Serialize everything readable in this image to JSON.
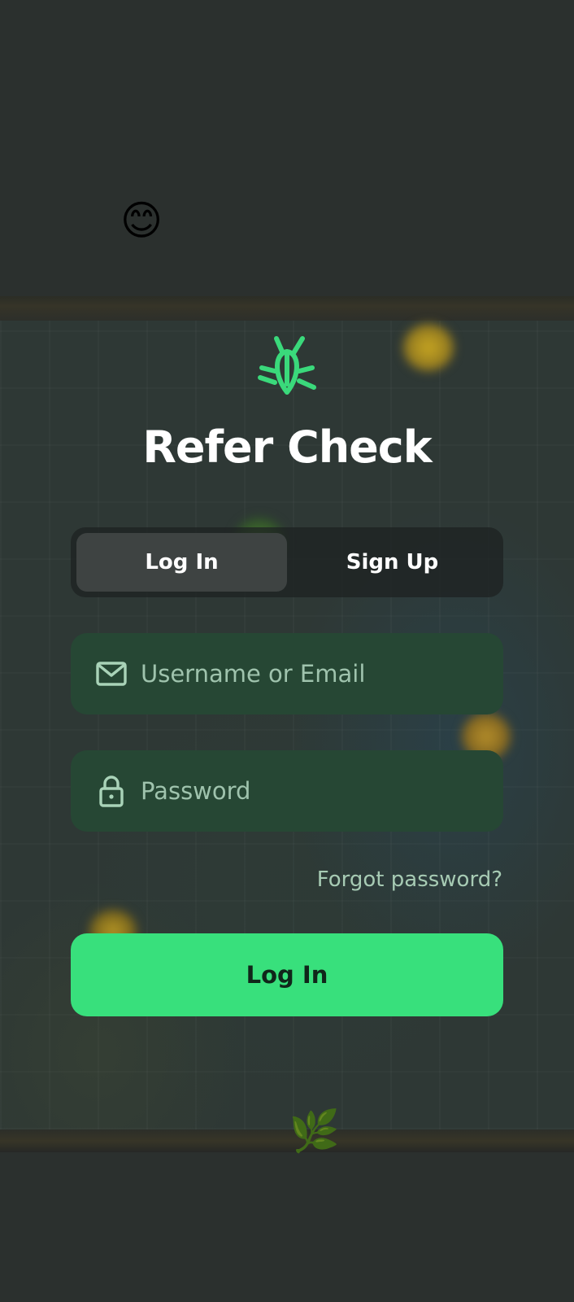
{
  "app": {
    "title": "Refer Check"
  },
  "decor": {
    "face_emoji": "😊",
    "leaf_emoji": "🌿"
  },
  "tabs": [
    {
      "label": "Log In",
      "active": true
    },
    {
      "label": "Sign Up",
      "active": false
    }
  ],
  "form": {
    "username_placeholder": "Username or Email",
    "username_value": "",
    "password_placeholder": "Password",
    "password_value": "",
    "forgot_label": "Forgot password?",
    "submit_label": "Log In"
  },
  "icons": {
    "logo": "bug-icon",
    "username": "mail-icon",
    "password": "lock-icon"
  },
  "colors": {
    "accent": "#38e07c",
    "field_bg": "#264734",
    "background": "#2b302e"
  }
}
